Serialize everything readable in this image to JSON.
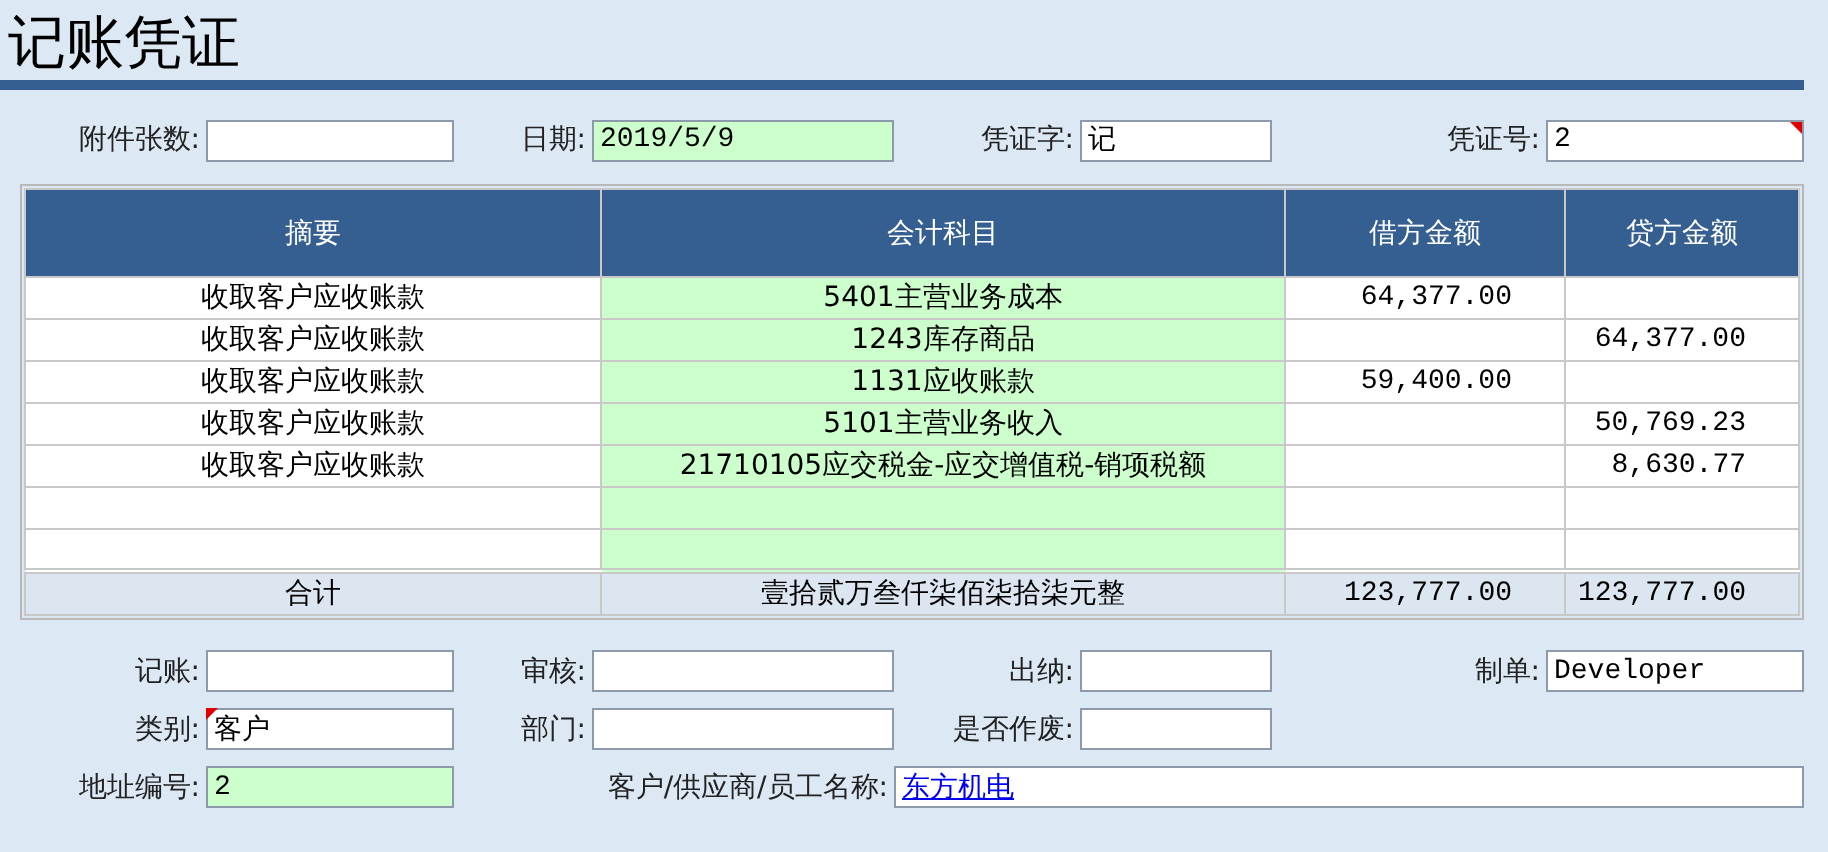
{
  "title": "记账凭证",
  "header_fields": [
    {
      "label": "附件张数:",
      "highlighted": false
    },
    {
      "label": "日期:",
      "value": "2019/5/9",
      "highlighted": true
    },
    {
      "label": "凭证字:",
      "value": "记",
      "highlighted": false
    },
    {
      "label": "凭证号:",
      "value": "2",
      "highlighted": false,
      "flagged": true
    }
  ],
  "table": {
    "columns": [
      {
        "label": "摘要",
        "highlighted": false
      },
      {
        "label": "会计科目",
        "highlighted": true
      },
      {
        "label": "借方金额",
        "highlighted": false
      },
      {
        "label": "贷方金额",
        "highlighted": false
      }
    ],
    "rows": [
      {
        "summary": "收取客户应收账款",
        "account": "5401主营业务成本",
        "debit": "64,377.00"
      },
      {
        "summary": "收取客户应收账款",
        "account": "1243库存商品",
        "credit": "64,377.00"
      },
      {
        "summary": "收取客户应收账款",
        "account": "1131应收账款",
        "debit": "59,400.00"
      },
      {
        "summary": "收取客户应收账款",
        "account": "5101主营业务收入",
        "credit": "50,769.23"
      },
      {
        "summary": "收取客户应收账款",
        "account": "21710105应交税金-应交增值税-销项税额",
        "credit": "8,630.77"
      },
      {},
      {}
    ],
    "total": {
      "label": "合计",
      "amount_in_words": "壹拾贰万叁仟柒佰柒拾柒元整",
      "debit": "123,777.00",
      "credit": "123,777.00"
    }
  },
  "footer_rows": [
    [
      {
        "label": "记账:",
        "highlighted": false
      },
      {
        "label": "审核:",
        "highlighted": false
      },
      {
        "label": "出纳:",
        "highlighted": false
      },
      {
        "label": "制单:",
        "value": "Developer",
        "highlighted": false
      }
    ],
    [
      {
        "label": "类别:",
        "value": "客户",
        "highlighted": false,
        "flagged": true
      },
      {
        "label": "部门:",
        "highlighted": false
      },
      {
        "label": "是否作废:",
        "highlighted": false
      }
    ],
    [
      {
        "label": "地址编号:",
        "value": "2",
        "highlighted": true
      },
      {
        "label": "客户/供应商/员工名称:",
        "value": "东方机电",
        "kind": "link",
        "highlighted": false
      }
    ]
  ]
}
